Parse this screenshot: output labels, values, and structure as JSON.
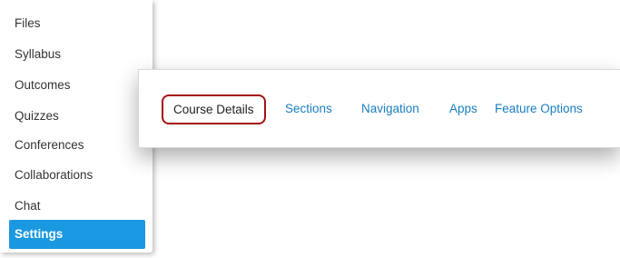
{
  "course_nav": {
    "items": [
      {
        "label": "Files"
      },
      {
        "label": "Syllabus"
      },
      {
        "label": "Outcomes"
      },
      {
        "label": "Quizzes"
      },
      {
        "label": "Conferences"
      },
      {
        "label": "Collaborations"
      },
      {
        "label": "Chat"
      },
      {
        "label": "Settings",
        "active": true
      }
    ]
  },
  "settings_tabs": {
    "tabs": [
      {
        "label": "Course Details",
        "highlighted": true
      },
      {
        "label": "Sections"
      },
      {
        "label": "Navigation"
      },
      {
        "label": "Apps"
      },
      {
        "label": "Feature Options"
      }
    ]
  },
  "colors": {
    "active_nav_bg": "#1a99e0",
    "link": "#1a7ec0",
    "highlight_border": "#a51313"
  }
}
